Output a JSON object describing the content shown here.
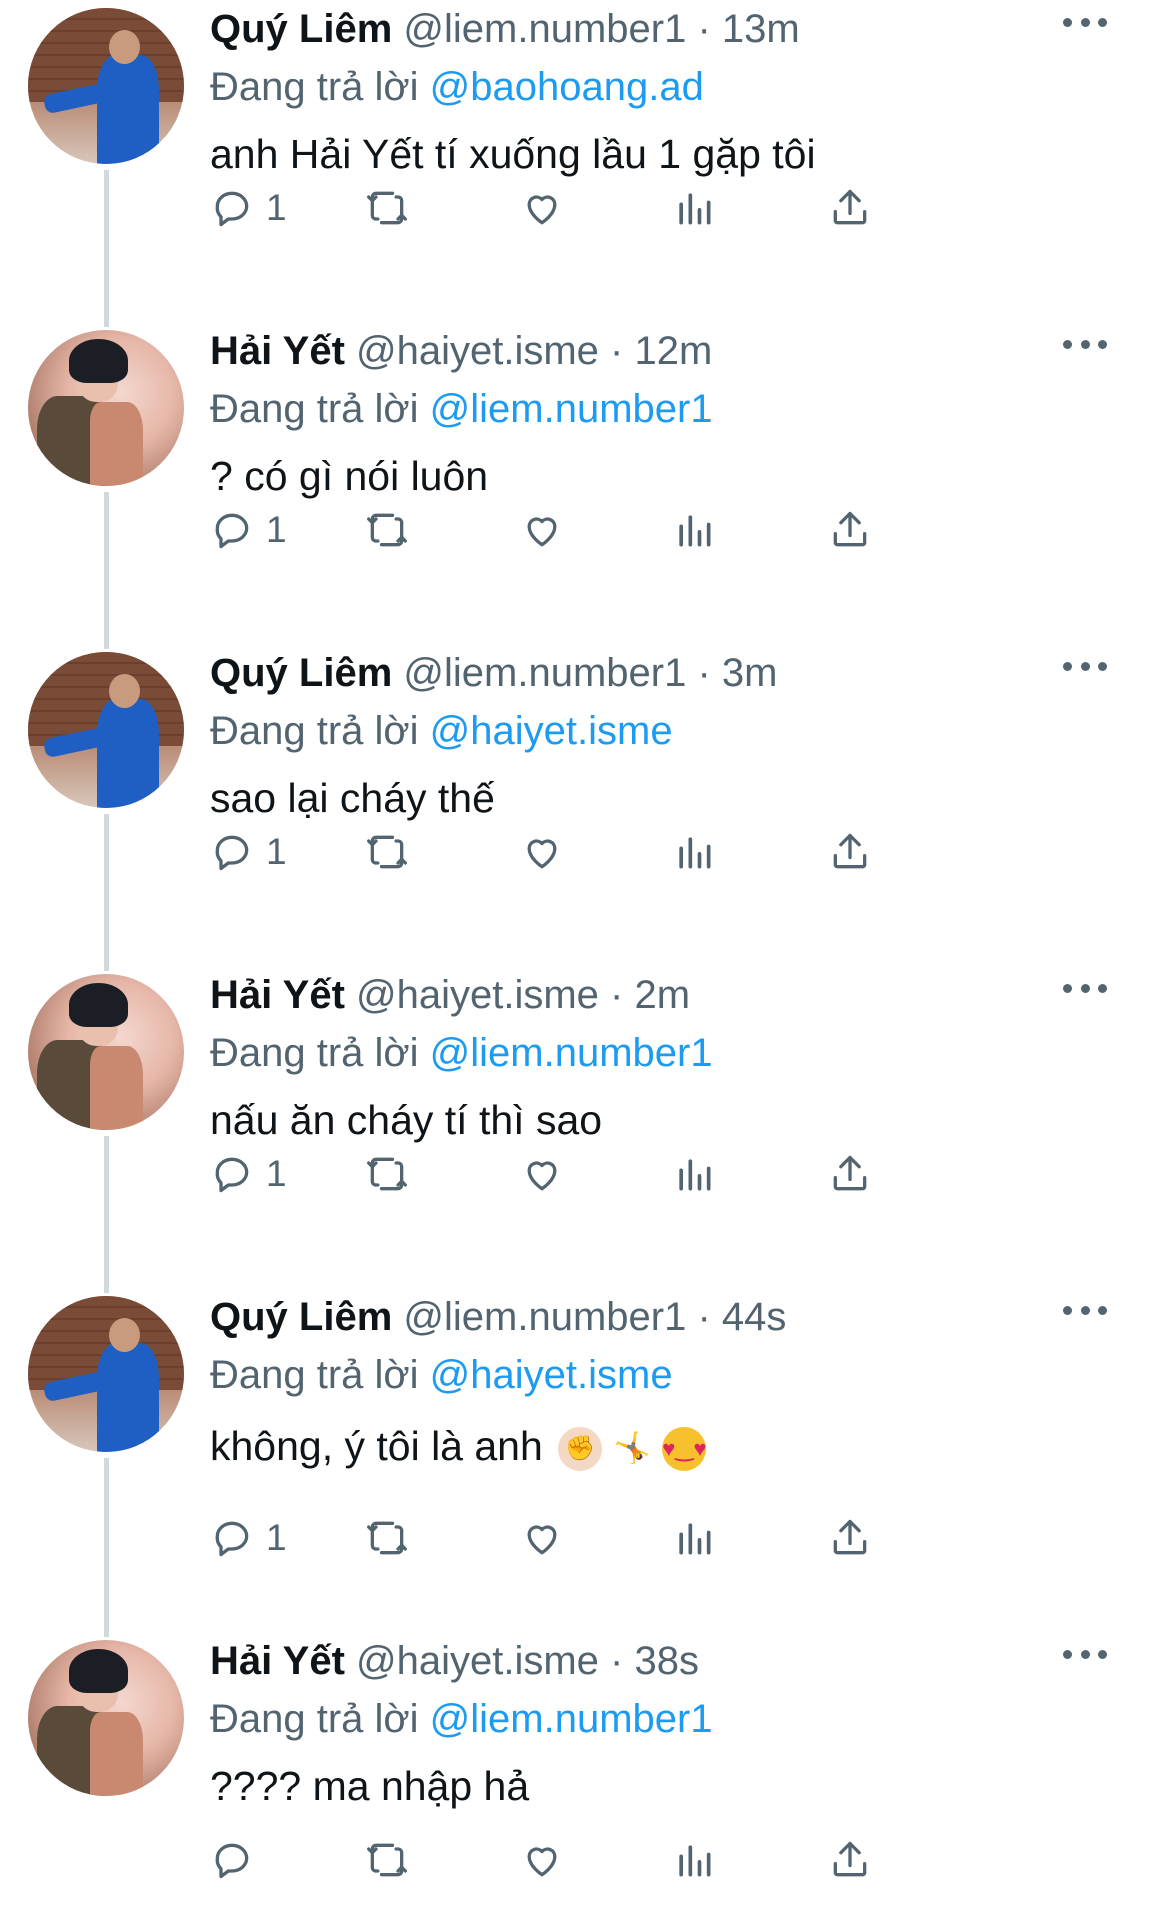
{
  "tweets": [
    {
      "name": "Quý Liêm",
      "handle": "@liem.number1",
      "time": "13m",
      "replying_label": "Đang trả lời",
      "replying_to": "@baohoang.ad",
      "text": "anh Hải Yết tí xuống lầu 1 gặp tôi",
      "emojis": [],
      "reply_count": "1",
      "avatar": "liem"
    },
    {
      "name": "Hải Yết",
      "handle": "@haiyet.isme",
      "time": "12m",
      "replying_label": "Đang trả lời",
      "replying_to": "@liem.number1",
      "text": "? có gì nói luôn",
      "emojis": [],
      "reply_count": "1",
      "avatar": "yet"
    },
    {
      "name": "Quý Liêm",
      "handle": "@liem.number1",
      "time": "3m",
      "replying_label": "Đang trả lời",
      "replying_to": "@haiyet.isme",
      "text": "sao lại cháy thế",
      "emojis": [],
      "reply_count": "1",
      "avatar": "liem"
    },
    {
      "name": "Hải Yết",
      "handle": "@haiyet.isme",
      "time": "2m",
      "replying_label": "Đang trả lời",
      "replying_to": "@liem.number1",
      "text": "nấu ăn cháy tí thì sao",
      "emojis": [],
      "reply_count": "1",
      "avatar": "yet"
    },
    {
      "name": "Quý Liêm",
      "handle": "@liem.number1",
      "time": "44s",
      "replying_label": "Đang trả lời",
      "replying_to": "@haiyet.isme",
      "text": "không, ý tôi là anh",
      "emojis": [
        "pointing-fist-emoji",
        "person-cartwheeling-emoji",
        "heart-eyes-emoji"
      ],
      "reply_count": "1",
      "avatar": "liem"
    },
    {
      "name": "Hải Yết",
      "handle": "@haiyet.isme",
      "time": "38s",
      "replying_label": "Đang trả lời",
      "replying_to": "@liem.number1",
      "text": "???? ma nhập hả",
      "emojis": [],
      "reply_count": "",
      "avatar": "yet"
    }
  ],
  "separator": " · ",
  "colors": {
    "link": "#1d9bf0",
    "secondary_text": "#536471",
    "primary_text": "#0f1419",
    "thread_line": "#cfd9de"
  },
  "icons": {
    "reply": "reply-icon",
    "retweet": "retweet-icon",
    "like": "heart-icon",
    "views": "views-icon",
    "share": "share-icon",
    "more": "more-dots-icon"
  }
}
